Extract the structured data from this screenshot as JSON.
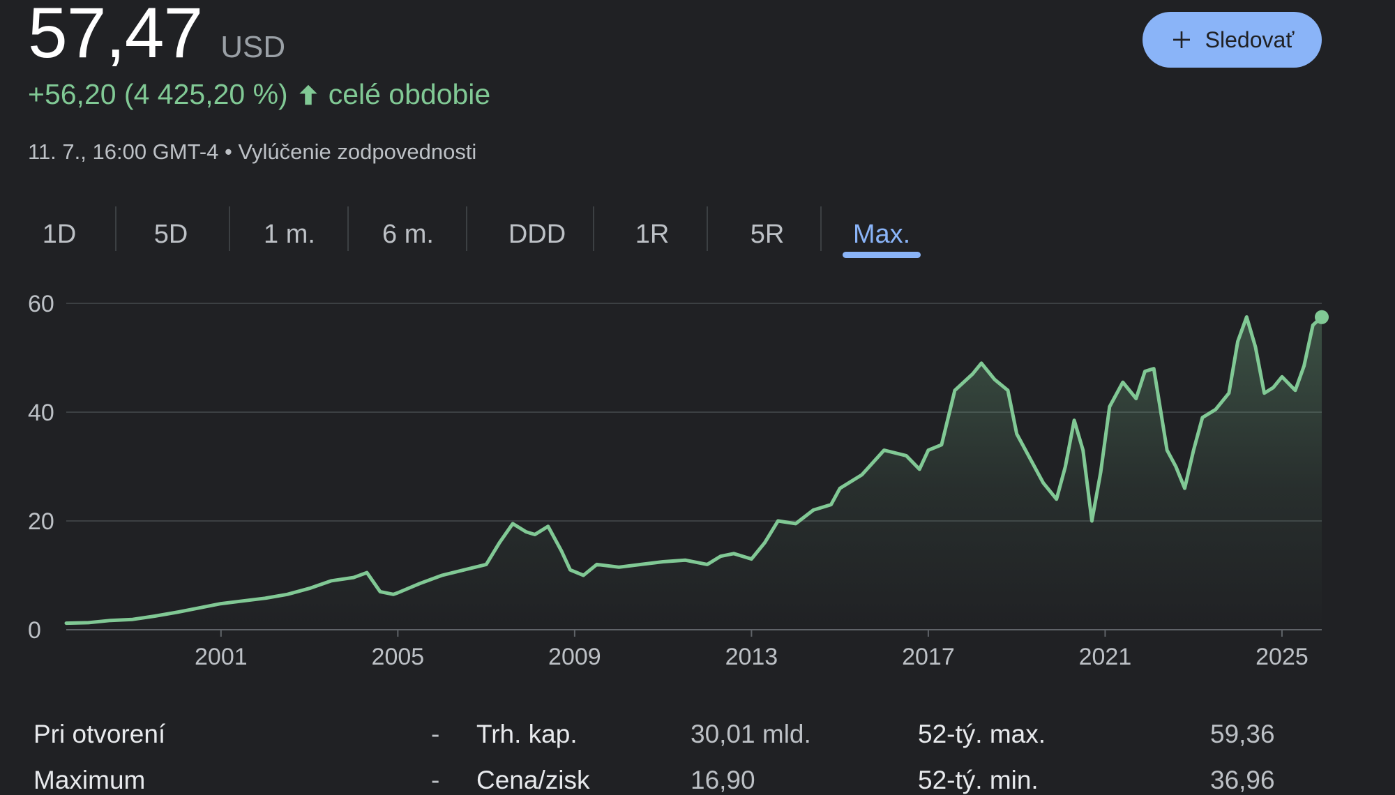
{
  "quote": {
    "price": "57,47",
    "currency": "USD",
    "change": "+56,20 (4 425,20 %)",
    "period": "celé obdobie",
    "timestamp": "11. 7., 16:00 GMT-4",
    "separator": "•",
    "disclaimer": "Vylúčenie zodpovednosti",
    "change_color": "#81c995"
  },
  "follow_button": {
    "label": "Sledovať",
    "icon": "plus-icon"
  },
  "tabs": [
    {
      "label": "1D",
      "active": false
    },
    {
      "label": "5D",
      "active": false
    },
    {
      "label": "1 m.",
      "active": false
    },
    {
      "label": "6 m.",
      "active": false
    },
    {
      "label": "DDD",
      "active": false
    },
    {
      "label": "1R",
      "active": false
    },
    {
      "label": "5R",
      "active": false
    },
    {
      "label": "Max.",
      "active": true
    }
  ],
  "chart_data": {
    "type": "area",
    "x_tick_labels": [
      "2001",
      "2005",
      "2009",
      "2013",
      "2017",
      "2021",
      "2025"
    ],
    "y_tick_labels": [
      "0",
      "20",
      "40",
      "60"
    ],
    "ylim": [
      0,
      60
    ],
    "xlim": [
      1997.5,
      2025.9
    ],
    "grid": true,
    "line_color": "#81c995",
    "x": [
      1997.5,
      1998,
      1998.5,
      1999,
      1999.5,
      2000,
      2000.5,
      2001,
      2001.5,
      2002,
      2002.5,
      2003,
      2003.5,
      2004,
      2004.3,
      2004.6,
      2004.9,
      2005,
      2005.5,
      2006,
      2006.5,
      2007,
      2007.3,
      2007.6,
      2007.9,
      2008.1,
      2008.4,
      2008.7,
      2008.9,
      2009.2,
      2009.5,
      2010,
      2010.5,
      2011,
      2011.5,
      2012,
      2012.3,
      2012.6,
      2013,
      2013.3,
      2013.6,
      2014,
      2014.4,
      2014.8,
      2015,
      2015.5,
      2016,
      2016.5,
      2016.8,
      2017,
      2017.3,
      2017.6,
      2018,
      2018.2,
      2018.5,
      2018.8,
      2019,
      2019.3,
      2019.6,
      2019.9,
      2020.1,
      2020.3,
      2020.5,
      2020.7,
      2020.9,
      2021.1,
      2021.4,
      2021.7,
      2021.9,
      2022.1,
      2022.4,
      2022.6,
      2022.8,
      2023,
      2023.2,
      2023.5,
      2023.8,
      2024,
      2024.2,
      2024.4,
      2024.6,
      2024.8,
      2025,
      2025.3,
      2025.5,
      2025.7,
      2025.9
    ],
    "y": [
      1.2,
      1.3,
      1.7,
      1.9,
      2.5,
      3.2,
      4.0,
      4.8,
      5.3,
      5.8,
      6.5,
      7.6,
      9.0,
      9.6,
      10.5,
      7.0,
      6.5,
      6.8,
      8.5,
      10.0,
      11.0,
      12.0,
      16.0,
      19.5,
      18.0,
      17.5,
      19.0,
      14.5,
      11.0,
      10.0,
      12.0,
      11.5,
      12.0,
      12.5,
      12.8,
      12.0,
      13.5,
      14.0,
      13.0,
      16.0,
      20.0,
      19.5,
      22.0,
      23.0,
      26.0,
      28.5,
      33.0,
      32.0,
      29.5,
      33.0,
      34.0,
      44.0,
      47.0,
      49.0,
      46.0,
      44.0,
      36.0,
      31.5,
      27.0,
      24.0,
      30.0,
      38.5,
      33.0,
      20.0,
      29.0,
      41.0,
      45.5,
      42.5,
      47.5,
      48.0,
      33.0,
      30.0,
      26.0,
      33.0,
      39.0,
      40.5,
      43.5,
      53.0,
      57.5,
      52.0,
      43.5,
      44.5,
      46.5,
      44.0,
      48.5,
      56.0,
      57.47
    ]
  },
  "stats": [
    {
      "label": "Pri otvorení",
      "value": "-"
    },
    {
      "label": "Trh. kap.",
      "value": "30,01 mld."
    },
    {
      "label": "52-tý. max.",
      "value": "59,36"
    },
    {
      "label": "Maximum",
      "value": "-"
    },
    {
      "label": "Cena/zisk",
      "value": "16,90"
    },
    {
      "label": "52-tý. min.",
      "value": "36,96"
    }
  ]
}
